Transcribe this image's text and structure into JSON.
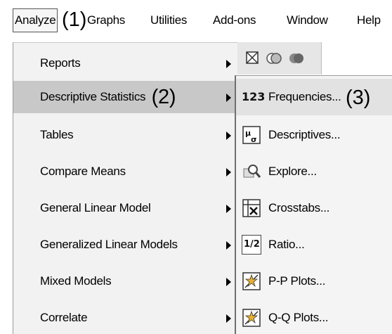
{
  "menubar": {
    "items": [
      {
        "label": "Analyze"
      },
      {
        "label": "Graphs"
      },
      {
        "label": "Utilities"
      },
      {
        "label": "Add-ons"
      },
      {
        "label": "Window"
      },
      {
        "label": "Help"
      }
    ],
    "callout_1": "(1)"
  },
  "analyze_menu": {
    "items": [
      {
        "label": "Reports"
      },
      {
        "label": "Descriptive Statistics"
      },
      {
        "label": "Tables"
      },
      {
        "label": "Compare Means"
      },
      {
        "label": "General Linear Model"
      },
      {
        "label": "Generalized Linear Models"
      },
      {
        "label": "Mixed Models"
      },
      {
        "label": "Correlate"
      }
    ],
    "callout_2": "(2)"
  },
  "descriptive_submenu": {
    "items": [
      {
        "label": "Frequencies...",
        "icon": "frequencies-icon",
        "icon_text": "123"
      },
      {
        "label": "Descriptives...",
        "icon": "descriptives-icon"
      },
      {
        "label": "Explore...",
        "icon": "explore-icon"
      },
      {
        "label": "Crosstabs...",
        "icon": "crosstabs-icon"
      },
      {
        "label": "Ratio...",
        "icon": "ratio-icon",
        "icon_text": "1/2"
      },
      {
        "label": "P-P Plots...",
        "icon": "pp-plot-icon"
      },
      {
        "label": "Q-Q Plots...",
        "icon": "qq-plot-icon"
      }
    ],
    "callout_3": "(3)"
  }
}
